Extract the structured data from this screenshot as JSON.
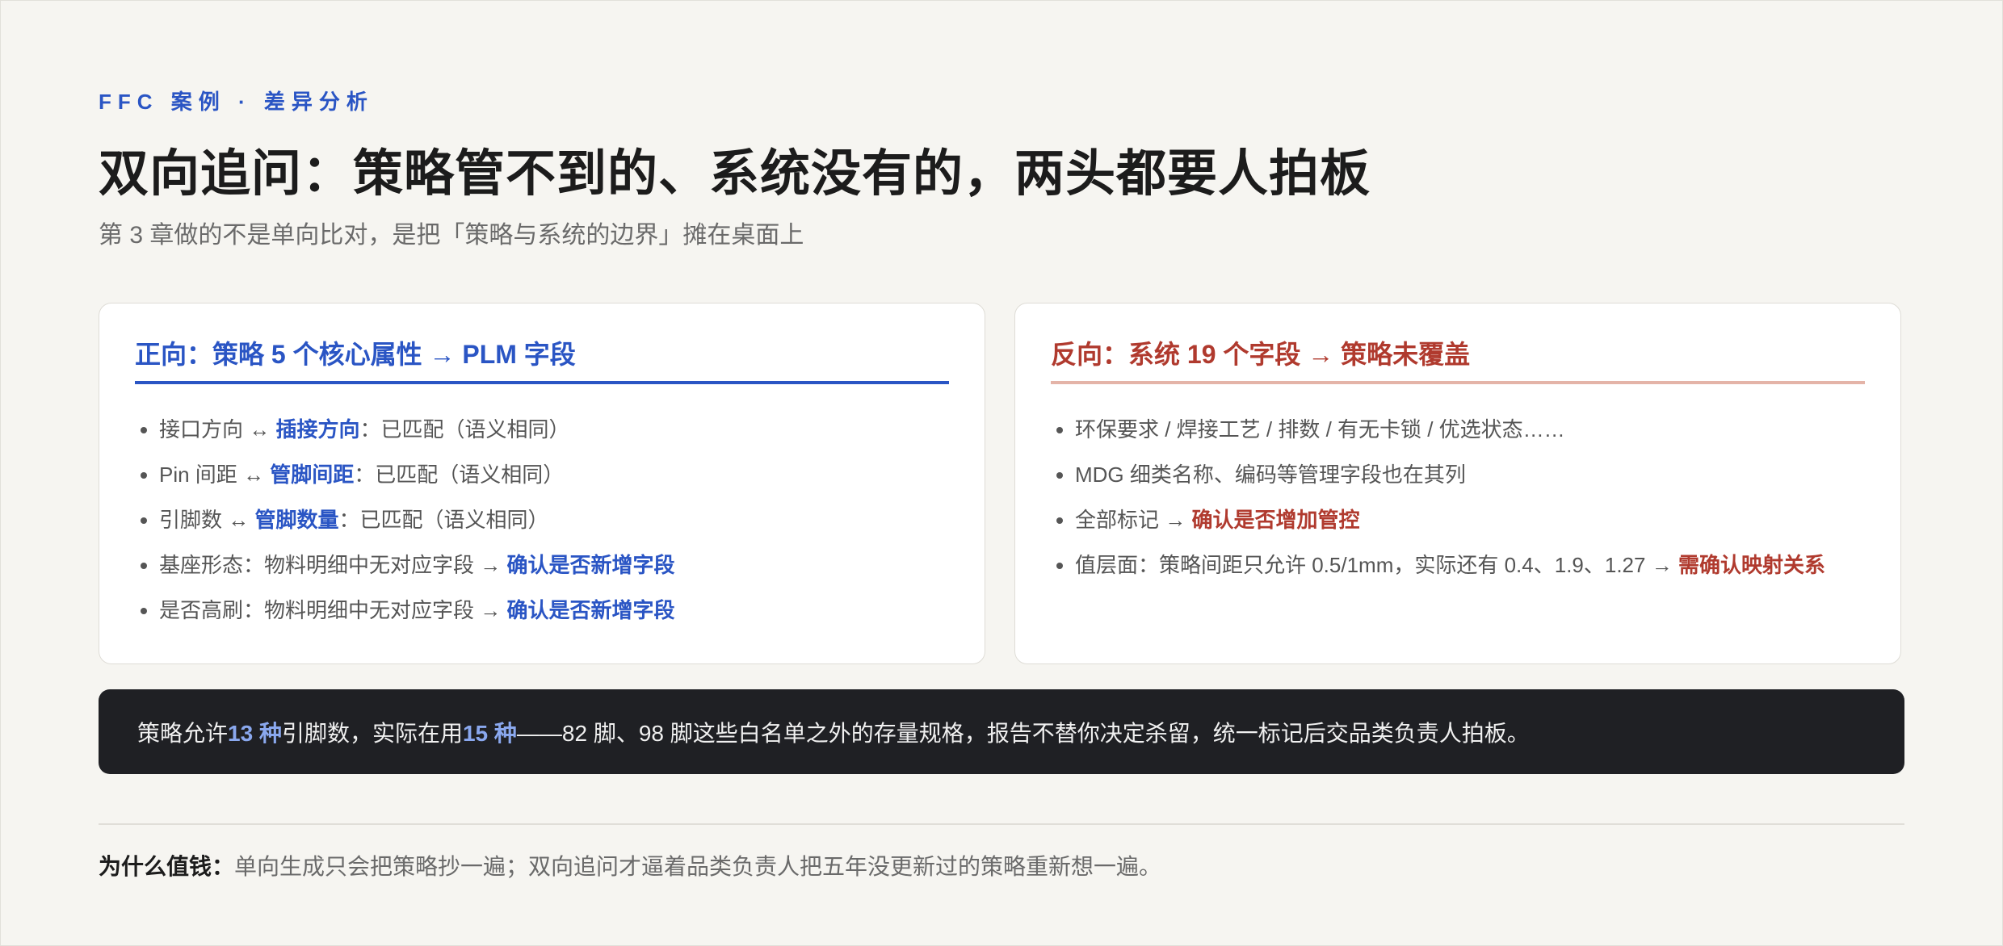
{
  "header": {
    "eyebrow": "FFC 案例 · 差异分析",
    "title": "双向追问：策略管不到的、系统没有的，两头都要人拍板",
    "subtitle": "第 3 章做的不是单向比对，是把「策略与系统的边界」摊在桌面上"
  },
  "forward": {
    "title": "正向：策略 5 个核心属性 → PLM 字段",
    "items": [
      {
        "pre": "接口方向 ↔ ",
        "hl": "插接方向",
        "post": "：已匹配（语义相同）"
      },
      {
        "pre": "Pin 间距 ↔ ",
        "hl": "管脚间距",
        "post": "：已匹配（语义相同）"
      },
      {
        "pre": "引脚数 ↔ ",
        "hl": "管脚数量",
        "post": "：已匹配（语义相同）"
      },
      {
        "pre": "基座形态：物料明细中无对应字段 → ",
        "hl": "确认是否新增字段",
        "post": ""
      },
      {
        "pre": "是否高刷：物料明细中无对应字段 → ",
        "hl": "确认是否新增字段",
        "post": ""
      }
    ]
  },
  "reverse": {
    "title": "反向：系统 19 个字段 → 策略未覆盖",
    "items": [
      {
        "pre": "环保要求 / 焊接工艺 / 排数 / 有无卡锁 / 优选状态……",
        "hl": ""
      },
      {
        "pre": "MDG 细类名称、编码等管理字段也在其列",
        "hl": ""
      },
      {
        "pre": "全部标记 → ",
        "hl": "确认是否增加管控"
      },
      {
        "pre": "值层面：策略间距只允许 0.5/1mm，实际还有 0.4、1.9、1.27 → ",
        "hl": "需确认映射关系"
      }
    ]
  },
  "callout": {
    "t1": "策略允许 ",
    "n1": "13 种",
    "t2": "引脚数，实际在用 ",
    "n2": "15 种",
    "t3": "——82 脚、98 脚这些白名单之外的存量规格，报告不替你决定杀留，统一标记后交品类负责人拍板。"
  },
  "footer": {
    "lead": "为什么值钱：",
    "text": "单向生成只会把策略抄一遍；双向追问才逼着品类负责人把五年没更新过的策略重新想一遍。"
  },
  "colors": {
    "accent_blue": "#2a55c4",
    "accent_red": "#b03a2e",
    "dark_bg": "#1f2024",
    "page_bg": "#f6f5f1"
  }
}
